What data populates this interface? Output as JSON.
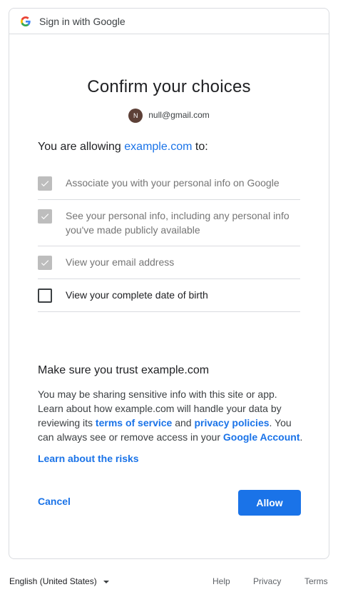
{
  "header": {
    "title": "Sign in with Google",
    "logo_icon": "google-g-icon"
  },
  "main": {
    "title": "Confirm your choices",
    "account": {
      "avatar_initial": "N",
      "email": "null@gmail.com"
    },
    "allowing": {
      "prefix": "You are allowing",
      "site": "example.com",
      "suffix": "to:"
    },
    "permissions": [
      {
        "label": "Associate you with your personal info on Google",
        "checked": true,
        "disabled": true
      },
      {
        "label": "See your personal info, including any personal info you've made publicly available",
        "checked": true,
        "disabled": true
      },
      {
        "label": "View your email address",
        "checked": true,
        "disabled": true
      },
      {
        "label": "View your complete date of birth",
        "checked": false,
        "disabled": false
      }
    ],
    "trust": {
      "heading": "Make sure you trust example.com",
      "text_1": "You may be sharing sensitive info with this site or app. Learn about how example.com will handle your data by reviewing its ",
      "terms_link": "terms of service",
      "text_2": " and ",
      "privacy_link": "privacy policies",
      "text_3": ". You can always see or remove access in your ",
      "account_link": "Google Account",
      "text_4": "."
    },
    "risks_link": "Learn about the risks",
    "cancel_label": "Cancel",
    "allow_label": "Allow"
  },
  "footer": {
    "language": "English (United States)",
    "help": "Help",
    "privacy": "Privacy",
    "terms": "Terms"
  },
  "colors": {
    "accent": "#1a73e8",
    "border": "#dadce0",
    "avatar_bg": "#5d4037"
  }
}
